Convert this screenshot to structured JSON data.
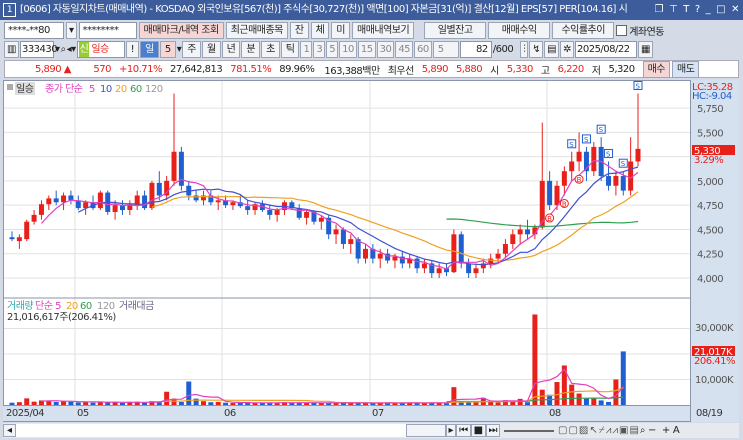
{
  "title": {
    "num": "1",
    "text": "[0606] 자동일지차트(매매내역) - KOSDAQ 외국인보유[567(천)] 주식수[30,727(천)] 액면[100] 자본금[31(억)] 결산[12월] EPS[57] PER[104.16] 시"
  },
  "row1": {
    "account": "****-**80",
    "password": "********",
    "btn_mark": "매매마크/내역 조회",
    "btn_recent": "최근매매종목",
    "btn_jan": "잔",
    "btn_che": "체",
    "btn_mi": "미",
    "btn_history": "매매내역보기",
    "btn_daily": "일별잔고",
    "btn_profit": "매매수익",
    "btn_trend": "수익률추이",
    "chk_link": "계좌연동"
  },
  "row2": {
    "code": "333430",
    "badge": "신",
    "name": "일승",
    "bang": "!",
    "period_day": "일",
    "period_n": "5",
    "p_week": "주",
    "p_month": "월",
    "p_year": "년",
    "p_min": "분",
    "p_sec": "초",
    "p_tick": "틱",
    "mins": [
      "1",
      "3",
      "5",
      "10",
      "15",
      "30",
      "45",
      "60"
    ],
    "min_sel": "5",
    "count": "82",
    "count_total": "/600",
    "date": "2025/08/22"
  },
  "row3": {
    "price": "5,890 ▲",
    "change": "570",
    "rate": "+10.71%",
    "volume": "27,642,813",
    "vol_rate": "781.51%",
    "turnover": "89.96%",
    "amount": "163,388백만",
    "best_label": "최우선",
    "ask": "5,890",
    "bid": "5,880",
    "open_label": "시",
    "open": "5,330",
    "high_label": "고",
    "high": "6,220",
    "low_label": "저",
    "low": "5,320",
    "buy": "매수",
    "sell": "매도"
  },
  "price_panel": {
    "label": "일승",
    "legend": [
      "종가 단순",
      "5",
      "10",
      "20",
      "60",
      "120"
    ],
    "lc": "LC:35.28",
    "hc": "HC:-9.04",
    "current": "5,330",
    "current_pct": "3.29%",
    "yticks": [
      "5,750",
      "5,500",
      "5,000",
      "4,750",
      "4,500",
      "4,250",
      "4,000"
    ]
  },
  "volume_panel": {
    "legend": [
      "거래량",
      "단순 5",
      "20",
      "60",
      "120",
      "거래대금"
    ],
    "info": "21,016,617주(206.41%)",
    "yticks": [
      "30,000K",
      "10,000K"
    ],
    "current": "21,017K",
    "current_pct": "206.41%"
  },
  "xaxis": [
    "2025/04",
    "05",
    "06",
    "07",
    "08"
  ],
  "end_date": "08/19",
  "colors": {
    "up": "#e8201a",
    "down": "#1f5fcf",
    "ma5": "#e040c0",
    "ma10": "#4050d0",
    "ma20": "#f0a020",
    "ma60": "#30a050",
    "ma120": "#999999"
  },
  "chart_data": {
    "type": "candlestick",
    "ylim": [
      3850,
      6000
    ],
    "vol_ylim": [
      0,
      38000
    ],
    "candles": [
      [
        4420,
        4480,
        4380,
        4400
      ],
      [
        4380,
        4450,
        4300,
        4420
      ],
      [
        4400,
        4600,
        4380,
        4580
      ],
      [
        4580,
        4700,
        4550,
        4650
      ],
      [
        4650,
        4800,
        4600,
        4760
      ],
      [
        4760,
        4850,
        4700,
        4820
      ],
      [
        4820,
        4900,
        4750,
        4780
      ],
      [
        4780,
        4880,
        4700,
        4850
      ],
      [
        4850,
        4900,
        4760,
        4800
      ],
      [
        4800,
        4850,
        4700,
        4720
      ],
      [
        4720,
        4800,
        4650,
        4780
      ],
      [
        4780,
        4850,
        4700,
        4720
      ],
      [
        4720,
        4900,
        4700,
        4880
      ],
      [
        4880,
        4900,
        4650,
        4680
      ],
      [
        4680,
        4800,
        4600,
        4750
      ],
      [
        4750,
        4800,
        4650,
        4700
      ],
      [
        4700,
        4800,
        4650,
        4750
      ],
      [
        4750,
        4900,
        4700,
        4850
      ],
      [
        4850,
        4900,
        4700,
        4720
      ],
      [
        4720,
        5000,
        4700,
        4980
      ],
      [
        4980,
        5100,
        4800,
        4850
      ],
      [
        4850,
        5050,
        4800,
        5000
      ],
      [
        5000,
        5900,
        4950,
        5300
      ],
      [
        5300,
        5350,
        4900,
        4950
      ],
      [
        4950,
        5000,
        4800,
        4850
      ],
      [
        4850,
        4900,
        4780,
        4800
      ],
      [
        4800,
        4900,
        4750,
        4850
      ],
      [
        4850,
        4900,
        4750,
        4780
      ],
      [
        4780,
        4850,
        4700,
        4800
      ],
      [
        4800,
        4850,
        4720,
        4750
      ],
      [
        4750,
        4800,
        4700,
        4780
      ],
      [
        4780,
        4850,
        4720,
        4740
      ],
      [
        4740,
        4800,
        4650,
        4700
      ],
      [
        4700,
        4780,
        4650,
        4760
      ],
      [
        4760,
        4800,
        4680,
        4700
      ],
      [
        4700,
        4750,
        4600,
        4650
      ],
      [
        4650,
        4720,
        4580,
        4700
      ],
      [
        4700,
        4800,
        4650,
        4780
      ],
      [
        4780,
        4800,
        4700,
        4720
      ],
      [
        4720,
        4760,
        4600,
        4620
      ],
      [
        4620,
        4700,
        4550,
        4680
      ],
      [
        4680,
        4700,
        4550,
        4580
      ],
      [
        4580,
        4650,
        4500,
        4620
      ],
      [
        4620,
        4650,
        4400,
        4450
      ],
      [
        4450,
        4550,
        4350,
        4500
      ],
      [
        4500,
        4520,
        4300,
        4350
      ],
      [
        4350,
        4450,
        4250,
        4400
      ],
      [
        4400,
        4420,
        4150,
        4200
      ],
      [
        4200,
        4350,
        4150,
        4300
      ],
      [
        4300,
        4350,
        4150,
        4200
      ],
      [
        4200,
        4300,
        4100,
        4250
      ],
      [
        4250,
        4300,
        4150,
        4180
      ],
      [
        4180,
        4250,
        4100,
        4220
      ],
      [
        4220,
        4280,
        4100,
        4150
      ],
      [
        4150,
        4250,
        4100,
        4200
      ],
      [
        4200,
        4220,
        4050,
        4100
      ],
      [
        4100,
        4200,
        4050,
        4150
      ],
      [
        4150,
        4180,
        4000,
        4050
      ],
      [
        4050,
        4150,
        4000,
        4100
      ],
      [
        4100,
        4150,
        4020,
        4060
      ],
      [
        4060,
        4500,
        4050,
        4450
      ],
      [
        4450,
        4480,
        4100,
        4150
      ],
      [
        4150,
        4200,
        4000,
        4050
      ],
      [
        4050,
        4150,
        4000,
        4100
      ],
      [
        4100,
        4200,
        4050,
        4150
      ],
      [
        4150,
        4250,
        4100,
        4200
      ],
      [
        4200,
        4300,
        4150,
        4250
      ],
      [
        4250,
        4400,
        4200,
        4350
      ],
      [
        4350,
        4500,
        4300,
        4450
      ],
      [
        4450,
        4550,
        4350,
        4500
      ],
      [
        4500,
        4600,
        4400,
        4450
      ],
      [
        4450,
        4550,
        4400,
        4520
      ],
      [
        4520,
        5600,
        4500,
        5000
      ],
      [
        5000,
        5100,
        4700,
        4750
      ],
      [
        4750,
        5000,
        4700,
        4950
      ],
      [
        4950,
        5150,
        4850,
        5100
      ],
      [
        5100,
        5300,
        5000,
        5200
      ],
      [
        5200,
        5500,
        5100,
        5300
      ],
      [
        5300,
        5350,
        5000,
        5100
      ],
      [
        5100,
        5400,
        5050,
        5350
      ],
      [
        5350,
        5450,
        5000,
        5050
      ],
      [
        5050,
        5200,
        4900,
        4950
      ],
      [
        4950,
        5100,
        4850,
        5050
      ],
      [
        5050,
        5100,
        4850,
        4900
      ],
      [
        4900,
        5450,
        4850,
        5200
      ],
      [
        5200,
        5900,
        5150,
        5330
      ]
    ],
    "volume": [
      900,
      1100,
      2600,
      1300,
      1800,
      1500,
      1200,
      1600,
      1300,
      1000,
      1200,
      900,
      1400,
      1000,
      1100,
      900,
      1000,
      1300,
      900,
      1500,
      1000,
      5200,
      2500,
      1200,
      9200,
      2500,
      1500,
      1100,
      1200,
      900,
      800,
      900,
      900,
      800,
      1000,
      800,
      900,
      1100,
      800,
      900,
      800,
      900,
      900,
      800,
      900,
      700,
      800,
      900,
      800,
      700,
      800,
      900,
      700,
      800,
      900,
      800,
      700,
      900,
      800,
      700,
      7000,
      1500,
      1300,
      1100,
      2800,
      1200,
      1000,
      1900,
      1400,
      2400,
      1100,
      35500,
      6000,
      4000,
      9000,
      15500,
      8000,
      4500,
      2500,
      2500,
      1800,
      1200,
      10000,
      21017
    ],
    "markers": {
      "buy_idx": [
        73,
        75,
        77
      ],
      "sell_idx": [
        76,
        78,
        80,
        81,
        83,
        85
      ]
    }
  }
}
